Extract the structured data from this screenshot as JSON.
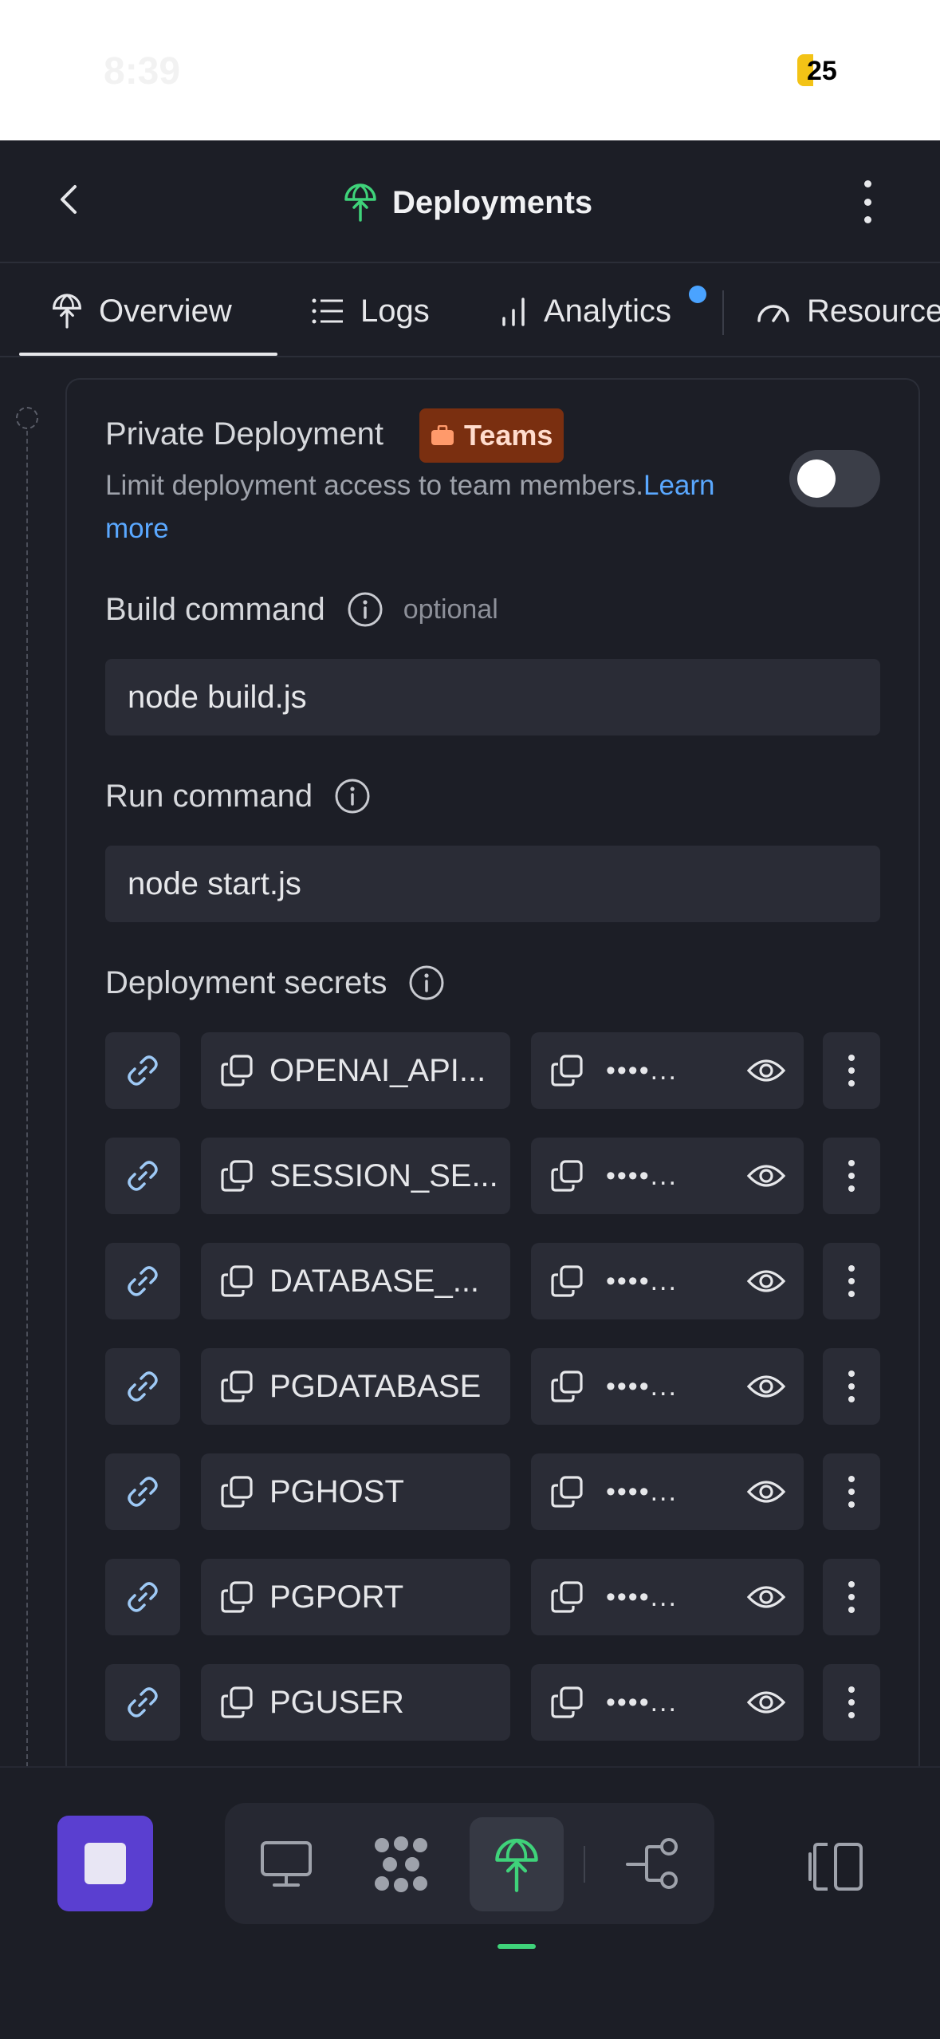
{
  "status_bar": {
    "time": "8:39",
    "battery": "25"
  },
  "header": {
    "title": "Deployments"
  },
  "tabs": [
    {
      "label": "Overview"
    },
    {
      "label": "Logs"
    },
    {
      "label": "Analytics"
    },
    {
      "label": "Resources"
    }
  ],
  "private_deployment": {
    "label": "Private Deployment",
    "badge": "Teams",
    "description": "Limit deployment access to team members.",
    "link_text": "Learn more",
    "enabled": false
  },
  "build_command": {
    "label": "Build command",
    "optional": "optional",
    "value": "node build.js"
  },
  "run_command": {
    "label": "Run command",
    "value": "node start.js"
  },
  "secrets": {
    "label": "Deployment secrets",
    "items": [
      {
        "name": "OPENAI_API...",
        "value": "••••..."
      },
      {
        "name": "SESSION_SE...",
        "value": "••••..."
      },
      {
        "name": "DATABASE_...",
        "value": "••••..."
      },
      {
        "name": "PGDATABASE",
        "value": "••••..."
      },
      {
        "name": "PGHOST",
        "value": "••••..."
      },
      {
        "name": "PGPORT",
        "value": "••••..."
      },
      {
        "name": "PGUSER",
        "value": "••••..."
      }
    ]
  },
  "colors": {
    "accent_green": "#3fd37a",
    "stop_purple": "#5a3fd0",
    "teams_badge": "#7a2f10",
    "link_blue": "#5aa8ff",
    "notification_dot": "#4aa3ff"
  },
  "icons": {
    "header": "deployment-icon",
    "dock": [
      "monitor-icon",
      "workspace-dots-icon",
      "deployment-icon",
      "git-branch-icon"
    ],
    "panel": "panel-toggle-icon"
  }
}
